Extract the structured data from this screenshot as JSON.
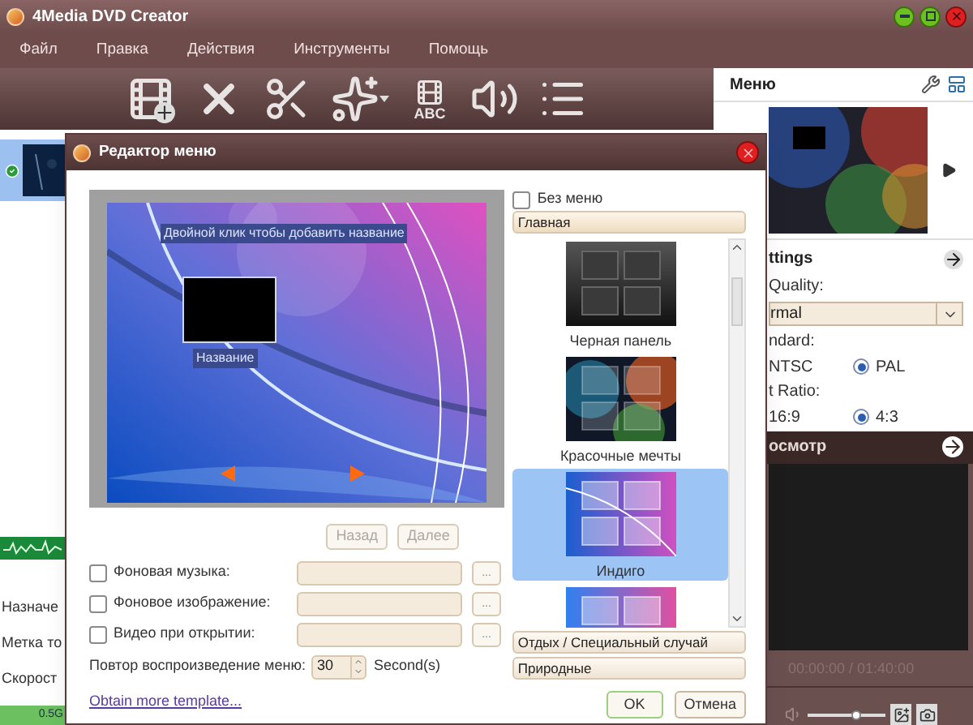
{
  "window": {
    "title": "4Media DVD Creator"
  },
  "menu": [
    "Файл",
    "Правка",
    "Действия",
    "Инструменты",
    "Помощь"
  ],
  "toolbar": {
    "subtitle_label": "ABC"
  },
  "clips": [
    {
      "selected": true
    }
  ],
  "side_labels": [
    "Назначе",
    "Метка то",
    "Скорост"
  ],
  "timeline_label": "0.5G",
  "right_panel": {
    "menu_title": "Меню",
    "settings_title": "ttings",
    "quality_label": "Quality:",
    "quality_value": "rmal",
    "standard_label": "ndard:",
    "ntsc_label": "NTSC",
    "pal": {
      "label": "PAL",
      "selected": true
    },
    "ratio_label": "t Ratio:",
    "ratio_wide_label": "16:9",
    "ratio_standard": {
      "label": "4:3",
      "selected": true
    },
    "preview_title": "осмотр",
    "time": "00:00:00 / 01:40:00",
    "volume": {
      "level": 0.62
    }
  },
  "dialog": {
    "title": "Редактор меню",
    "preview_caption": "Двойной клик чтобы добавить название",
    "thumb_label": "Название",
    "nav": [
      {
        "label": "Назад",
        "disabled": true
      },
      {
        "label": "Далее",
        "disabled": true
      }
    ],
    "options": [
      {
        "label": "Фоновая музыка:",
        "checked": false,
        "browse": "..."
      },
      {
        "label": "Фоновое изображение:",
        "checked": false,
        "browse": "..."
      },
      {
        "label": "Видео при открытии:",
        "checked": false,
        "browse": "..."
      }
    ],
    "repeat_label": "Повтор воспроизведение меню:",
    "repeat_value": "30",
    "repeat_unit": "Second(s)",
    "link": "Obtain more template...",
    "no_menu": {
      "label": "Без меню",
      "checked": false
    },
    "group_title": "Главная",
    "templates": [
      {
        "label": "Черная панель",
        "kind": "dark",
        "selected": false
      },
      {
        "label": "Красочные мечты",
        "kind": "colorful",
        "selected": false
      },
      {
        "label": "Индиго",
        "kind": "indigo",
        "selected": true
      },
      {
        "kind": "pink",
        "selected": false
      }
    ],
    "categories": [
      "Отдых / Специальный случай",
      "Природные"
    ],
    "buttons": [
      {
        "label": "OK",
        "kind": "primary"
      },
      {
        "label": "Отмена",
        "kind": "secondary"
      }
    ]
  }
}
